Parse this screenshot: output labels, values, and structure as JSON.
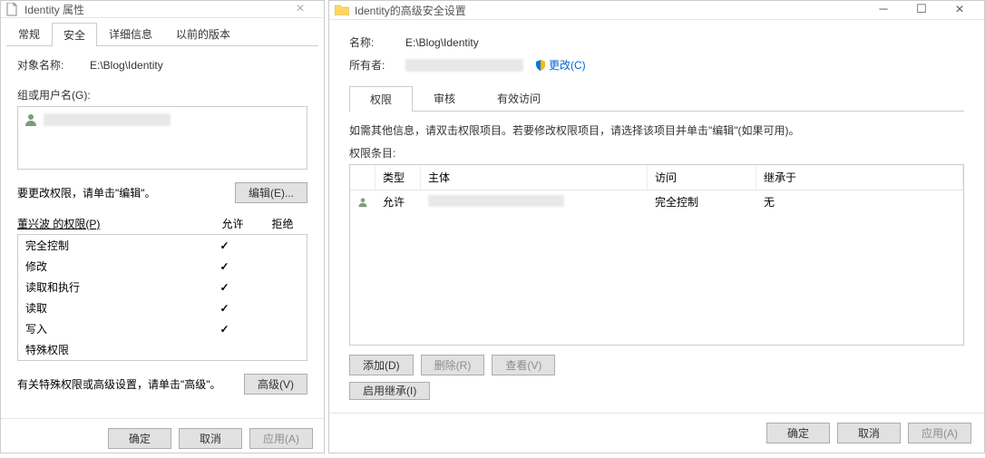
{
  "properties_dialog": {
    "title": "Identity 属性",
    "tabs": [
      "常规",
      "安全",
      "详细信息",
      "以前的版本"
    ],
    "active_tab_index": 1,
    "object_name_label": "对象名称:",
    "object_name_value": "E:\\Blog\\Identity",
    "group_users_label": "组或用户名(G):",
    "edit_hint": "要更改权限，请单击\"编辑\"。",
    "edit_button": "编辑(E)...",
    "permissions_for_label": "董兴波 的权限(P)",
    "allow_header": "允许",
    "deny_header": "拒绝",
    "permissions": [
      {
        "name": "完全控制",
        "allow": true,
        "deny": false
      },
      {
        "name": "修改",
        "allow": true,
        "deny": false
      },
      {
        "name": "读取和执行",
        "allow": true,
        "deny": false
      },
      {
        "name": "读取",
        "allow": true,
        "deny": false
      },
      {
        "name": "写入",
        "allow": true,
        "deny": false
      },
      {
        "name": "特殊权限",
        "allow": false,
        "deny": false
      }
    ],
    "advanced_hint": "有关特殊权限或高级设置，请单击\"高级\"。",
    "advanced_button": "高级(V)",
    "ok_button": "确定",
    "cancel_button": "取消",
    "apply_button": "应用(A)"
  },
  "advanced_dialog": {
    "title": "Identity的高级安全设置",
    "name_label": "名称:",
    "name_value": "E:\\Blog\\Identity",
    "owner_label": "所有者:",
    "change_link": "更改(C)",
    "tabs": [
      "权限",
      "审核",
      "有效访问"
    ],
    "active_tab_index": 0,
    "instruction": "如需其他信息，请双击权限项目。若要修改权限项目，请选择该项目并单击\"编辑\"(如果可用)。",
    "entries_label": "权限条目:",
    "headers": {
      "type": "类型",
      "principal": "主体",
      "access": "访问",
      "inherit": "继承于"
    },
    "entries": [
      {
        "type": "允许",
        "access": "完全控制",
        "inherit": "无"
      }
    ],
    "add_button": "添加(D)",
    "remove_button": "删除(R)",
    "view_button": "查看(V)",
    "enable_inherit_button": "启用继承(I)",
    "ok_button": "确定",
    "cancel_button": "取消",
    "apply_button": "应用(A)"
  }
}
